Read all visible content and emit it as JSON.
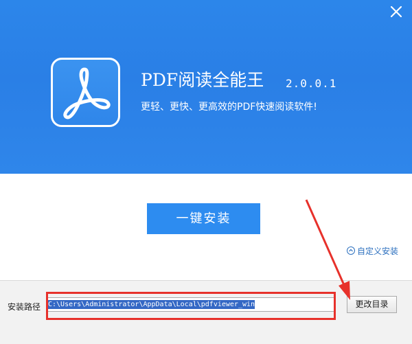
{
  "window": {
    "close_icon": "close-icon"
  },
  "header": {
    "app_name": "PDF阅读全能王",
    "version": "2.0.0.1",
    "tagline": "更轻、更快、更高效的PDF快速阅读软件!",
    "app_icon": "acrobat-pdf-icon"
  },
  "main": {
    "install_button_label": "一键安装",
    "custom_install_label": "自定义安装",
    "custom_install_icon": "chevron-up-circle-icon"
  },
  "footer": {
    "path_label": "安装路径",
    "path_value": "C:\\Users\\Administrator\\AppData\\Local\\pdfviewer_win",
    "browse_button_label": "更改目录"
  },
  "colors": {
    "banner_blue": "#2c86ea",
    "install_button": "#2d8cf0",
    "annotation_red": "#e7312b",
    "link_blue": "#2b6fbe"
  }
}
